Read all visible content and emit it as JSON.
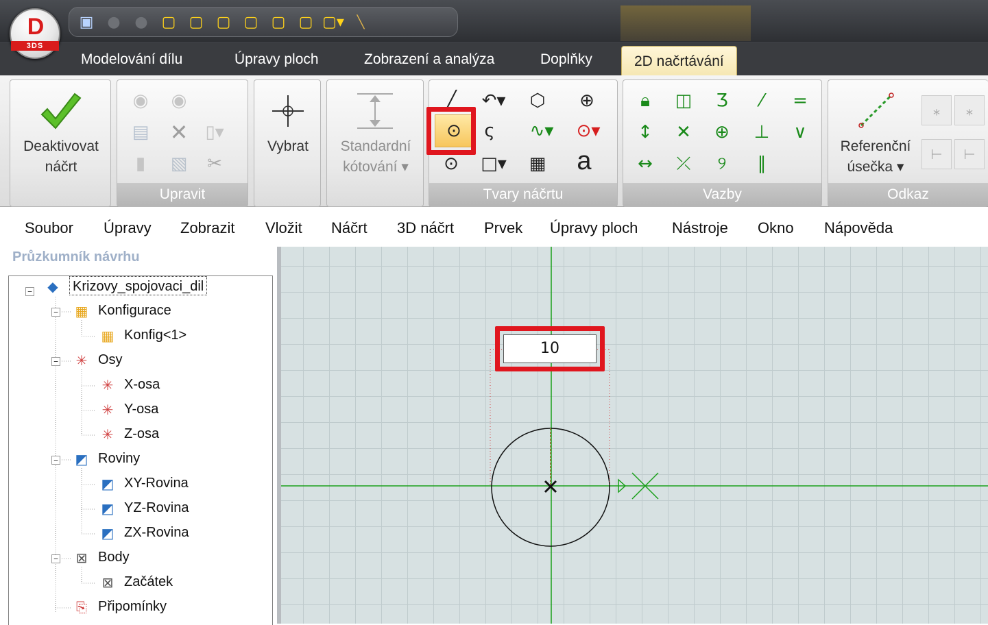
{
  "app": {
    "logo_letter": "D",
    "logo_sub": "3DS"
  },
  "ribbon_tabs": [
    "Modelování dílu",
    "Úpravy ploch",
    "Zobrazení a analýza",
    "Doplňky",
    "2D načrtávání"
  ],
  "ribbon": {
    "deactivate": {
      "line1": "Deaktivovat",
      "line2": "náčrt"
    },
    "upravit_label": "Upravit",
    "select_label": "Vybrat",
    "dimension": {
      "line1": "Standardní",
      "line2": "kótování ▾"
    },
    "shapes_label": "Tvary náčrtu",
    "text_glyph": "a",
    "constraints_label": "Vazby",
    "reference": {
      "line1": "Referenční",
      "line2": "úsečka ▾"
    },
    "odkaz_label": "Odkaz"
  },
  "menu": [
    "Soubor",
    "Úpravy",
    "Zobrazit",
    "Vložit",
    "Náčrt",
    "3D náčrt",
    "Prvek",
    "Úpravy ploch",
    "Nástroje",
    "Okno",
    "Nápověda"
  ],
  "explorer": {
    "title": "Průzkumník návrhu",
    "root": "Krizovy_spojovaci_dil",
    "konfigurace": "Konfigurace",
    "konfig1": "Konfig<1>",
    "osy": "Osy",
    "xosa": "X-osa",
    "yosa": "Y-osa",
    "zosa": "Z-osa",
    "roviny": "Roviny",
    "xy": "XY-Rovina",
    "yz": "YZ-Rovina",
    "zx": "ZX-Rovina",
    "body": "Body",
    "zacatek": "Začátek",
    "pripominky": "Připomínky"
  },
  "canvas": {
    "dimension_value": "10"
  },
  "colors": {
    "highlight": "#e0161e",
    "axis": "#1aa01a",
    "active_tab": "#f5e6b0"
  }
}
